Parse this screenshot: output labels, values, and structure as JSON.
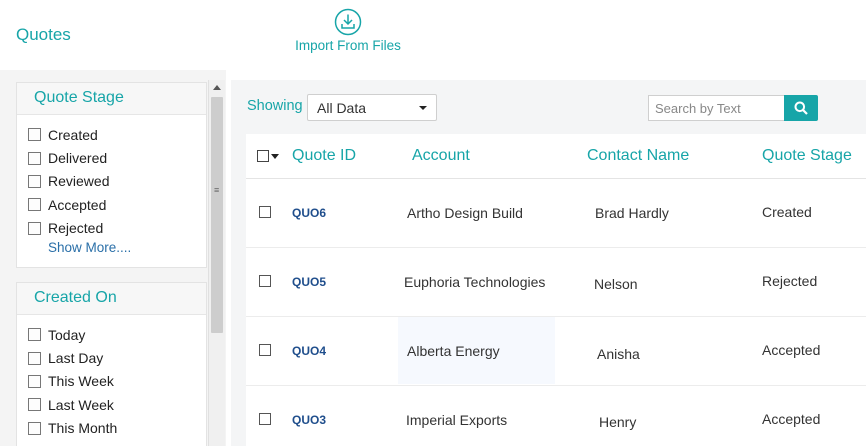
{
  "header": {
    "title": "Quotes",
    "import_label": "Import From Files",
    "import_icon": "download-icon"
  },
  "sidebar": {
    "panels": [
      {
        "title": "Quote Stage",
        "items": [
          "Created",
          "Delivered",
          "Reviewed",
          "Accepted",
          "Rejected"
        ],
        "show_more": "Show More...."
      },
      {
        "title": "Created On",
        "items": [
          "Today",
          "Last Day",
          "This Week",
          "Last Week",
          "This Month"
        ]
      }
    ]
  },
  "toolbar": {
    "showing_label": "Showing",
    "filter_value": "All Data",
    "search_placeholder": "Search by Text",
    "search_icon": "search-icon"
  },
  "table": {
    "columns": [
      "Quote ID",
      "Account",
      "Contact Name",
      "Quote Stage"
    ],
    "rows": [
      {
        "id": "QUO6",
        "account": "Artho Design Build",
        "contact": "Brad Hardly",
        "stage": "Created"
      },
      {
        "id": "QUO5",
        "account": "Euphoria Technologies",
        "contact": "Nelson",
        "stage": "Rejected"
      },
      {
        "id": "QUO4",
        "account": "Alberta Energy",
        "contact": "Anisha",
        "stage": "Accepted"
      },
      {
        "id": "QUO3",
        "account": "Imperial Exports",
        "contact": "Henry",
        "stage": "Accepted"
      }
    ]
  },
  "colors": {
    "accent": "#17a5a8",
    "link": "#1f4e8c",
    "sidebar_bg": "#f4f4f4"
  }
}
